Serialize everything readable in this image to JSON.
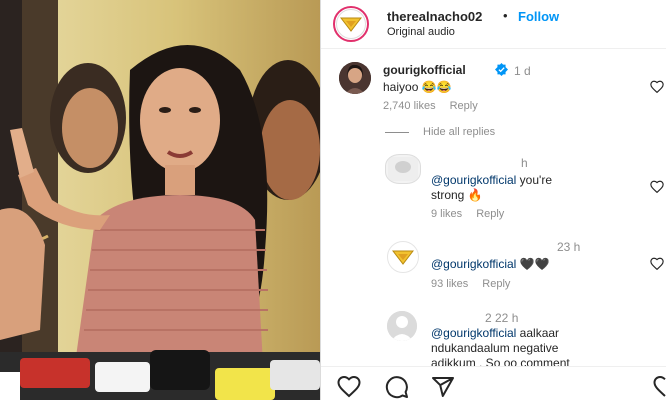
{
  "header": {
    "username": "therealnacho02",
    "separator": "•",
    "follow_label": "Follow",
    "audio_label": "Original audio"
  },
  "comments": [
    {
      "username": "gourigkofficial",
      "verified": true,
      "age": "1 d",
      "text": "haiyoo 😂😂",
      "likes": "2,740 likes",
      "reply_label": "Reply"
    }
  ],
  "hide_replies_label": "Hide all replies",
  "replies": [
    {
      "username": "",
      "age": "h",
      "mention": "@gourigkofficial",
      "text": " you're",
      "text_line2": "strong 🔥",
      "likes": "9 likes",
      "reply_label": "Reply"
    },
    {
      "username": "",
      "age": "23 h",
      "mention": "@gourigkofficial",
      "text": " 🖤🖤",
      "likes": "93 likes",
      "reply_label": "Reply"
    },
    {
      "username": "",
      "age": "2 22 h",
      "mention": "@gourigkofficial",
      "text": " aalkaar",
      "text_line2": "ndukandaalum negative",
      "text_line3": "adikkum . So oo comment"
    }
  ],
  "colors": {
    "accent": "#0095f6",
    "mention": "#00376b",
    "text": "#262626",
    "muted": "#8e8e8e",
    "story_ring": "#e1306c"
  },
  "icons": [
    "chips-logo-icon",
    "verified-badge-icon",
    "heart-icon",
    "comment-icon",
    "share-icon",
    "default-avatar-icon"
  ]
}
